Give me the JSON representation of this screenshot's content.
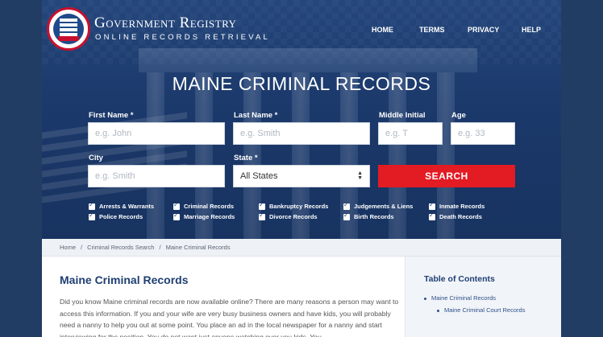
{
  "header": {
    "brand_title": "Government Registry",
    "brand_subtitle": "ONLINE RECORDS RETRIEVAL",
    "nav": [
      "HOME",
      "TERMS",
      "PRIVACY",
      "HELP"
    ]
  },
  "hero": {
    "title": "MAINE CRIMINAL RECORDS"
  },
  "form": {
    "first_name_label": "First Name *",
    "first_name_placeholder": "e.g. John",
    "last_name_label": "Last Name *",
    "last_name_placeholder": "e.g. Smith",
    "middle_initial_label": "Middle Initial",
    "middle_initial_placeholder": "e.g. T",
    "age_label": "Age",
    "age_placeholder": "e.g. 33",
    "city_label": "City",
    "city_placeholder": "e.g. Smith",
    "state_label": "State *",
    "state_value": "All States",
    "search_label": "SEARCH",
    "checkboxes": [
      "Arrests & Warrants",
      "Criminal Records",
      "Bankruptcy Records",
      "Judgements & Liens",
      "Inmate Records",
      "Police Records",
      "Marriage Records",
      "Divorce Records",
      "Birth Records",
      "Death Records"
    ]
  },
  "breadcrumb": [
    "Home",
    "Criminal Records Search",
    "Maine Criminal Records"
  ],
  "content": {
    "title": "Maine Criminal Records",
    "paragraph": "Did you know Maine criminal records are now available online? There are many reasons a person may want to access this information. If you and your wife are very busy business owners and have kids, you will probably need a nanny to help you out at some point. You place an ad in the local newspaper for a nanny and start interviewing for the position. You do not want just anyone watching over you kids. You"
  },
  "toc": {
    "title": "Table of Contents",
    "items": [
      "Maine Criminal Records",
      "Maine Criminal Court Records"
    ]
  },
  "colors": {
    "page_bg": "#223d64",
    "hero_blue": "#1f3f73",
    "search_red": "#e31b23",
    "title_blue": "#1f3f73"
  }
}
